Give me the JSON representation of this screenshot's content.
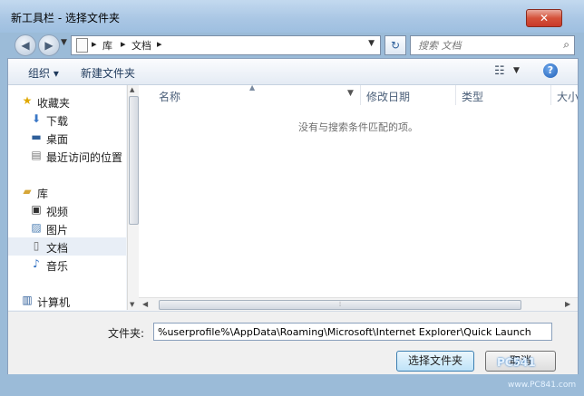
{
  "window": {
    "title": "新工具栏 - 选择文件夹",
    "close_glyph": "✕"
  },
  "navbar": {
    "back_glyph": "◀",
    "forward_glyph": "▶",
    "breadcrumb": [
      "库",
      "文档"
    ],
    "separator": "▸",
    "refresh_glyph": "↻",
    "search_placeholder": "搜索 文档",
    "search_glyph": "⌕"
  },
  "toolbar": {
    "organize_label": "组织 ▾",
    "new_folder_label": "新建文件夹",
    "views_glyph": "☷",
    "help_glyph": "?"
  },
  "nav_pane": {
    "favorites_header": "收藏夹",
    "favorites": [
      "下载",
      "桌面",
      "最近访问的位置"
    ],
    "libraries_header": "库",
    "libraries": [
      "视频",
      "图片",
      "文档",
      "音乐"
    ],
    "computer_header": "计算机",
    "selected_item": "文档"
  },
  "columns": [
    "名称",
    "修改日期",
    "类型",
    "大小"
  ],
  "empty_message": "没有与搜索条件匹配的项。",
  "folder": {
    "label": "文件夹:",
    "value": "%userprofile%\\AppData\\Roaming\\Microsoft\\Internet Explorer\\Quick Launch"
  },
  "buttons": {
    "select_folder": "选择文件夹",
    "cancel": "取消"
  },
  "watermark": {
    "main": "PC541",
    "sub": "www.PC841.com"
  },
  "colors": {
    "title_bar": "#a9c6e4",
    "close_button": "#d5523a",
    "selection": "#e8eef6",
    "accent": "#1e395b"
  }
}
